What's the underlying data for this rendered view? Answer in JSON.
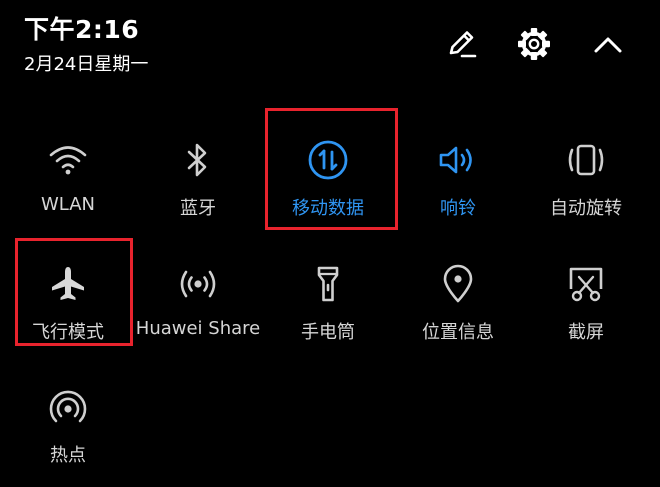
{
  "status": {
    "time": "下午2:16",
    "date": "2月24日星期一"
  },
  "header": {
    "edit_icon": "edit-pencil-icon",
    "settings_icon": "gear-icon",
    "collapse_icon": "chevron-up-icon"
  },
  "tiles": [
    {
      "label": "WLAN",
      "icon": "wifi-icon",
      "active": false
    },
    {
      "label": "蓝牙",
      "icon": "bluetooth-icon",
      "active": false
    },
    {
      "label": "移动数据",
      "icon": "mobile-data-icon",
      "active": true
    },
    {
      "label": "响铃",
      "icon": "speaker-icon",
      "active": true
    },
    {
      "label": "自动旋转",
      "icon": "auto-rotate-icon",
      "active": false
    },
    {
      "label": "飞行模式",
      "icon": "airplane-icon",
      "active": false
    },
    {
      "label": "Huawei Share",
      "icon": "huawei-share-icon",
      "active": false
    },
    {
      "label": "手电筒",
      "icon": "flashlight-icon",
      "active": false
    },
    {
      "label": "位置信息",
      "icon": "location-pin-icon",
      "active": false
    },
    {
      "label": "截屏",
      "icon": "screenshot-icon",
      "active": false
    },
    {
      "label": "热点",
      "icon": "hotspot-icon",
      "active": false
    }
  ],
  "colors": {
    "background": "#000000",
    "text": "#d6d6d6",
    "icon": "#cfcfcf",
    "active": "#2f95f2",
    "highlight": "#e8232d"
  }
}
